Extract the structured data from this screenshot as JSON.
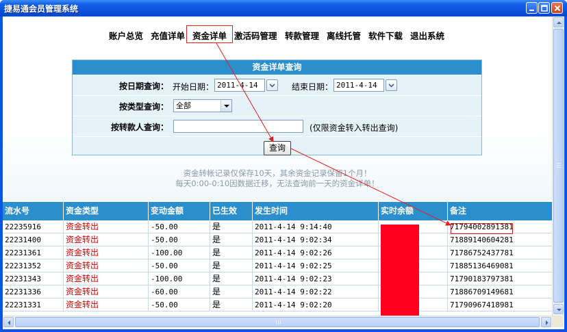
{
  "window": {
    "title": "捷易通会员管理系统",
    "accent": "#2a8fcc",
    "title_bar_color": "#0a55e6"
  },
  "nav": {
    "items": [
      {
        "label": "账户总览",
        "name": "nav-account-overview"
      },
      {
        "label": "充值详单",
        "name": "nav-recharge-detail"
      },
      {
        "label": "资金详单",
        "name": "nav-fund-detail",
        "selected": true
      },
      {
        "label": "激活码管理",
        "name": "nav-activation-code"
      },
      {
        "label": "转款管理",
        "name": "nav-transfer-mgmt"
      },
      {
        "label": "离线托管",
        "name": "nav-offline-hosting"
      },
      {
        "label": "软件下载",
        "name": "nav-software-download"
      },
      {
        "label": "退出系统",
        "name": "nav-exit"
      }
    ]
  },
  "query": {
    "title": "资金详单查询",
    "date_label": "按日期查询：",
    "start_label": "开始日期：",
    "start_value": "2011-4-14",
    "end_label": "结束日期：",
    "end_value": "2011-4-14",
    "type_label": "按类型查询：",
    "type_value": "全部",
    "payee_label": "按转款人查询：",
    "payee_value": "",
    "payee_hint": "(仅限资金转入转出查询)",
    "button": "查询"
  },
  "notice": {
    "line1": "资金转帐记录仅保存10天，其余资金记录保留1个月！",
    "line2": "每天0:00-0:10因数据迁移，无法查询前一天的资金详单！"
  },
  "table": {
    "headers": [
      "流水号",
      "资金类型",
      "变动金额",
      "已生效",
      "发生时间",
      "实时余额",
      "备注"
    ],
    "rows": [
      {
        "id": "22235916",
        "type": "资金转出",
        "amount": "-50.00",
        "effective": "是",
        "time": "2011-4-14  9:14:40",
        "balance": "",
        "note": "71794002891381"
      },
      {
        "id": "22231400",
        "type": "资金转出",
        "amount": "-50.00",
        "effective": "是",
        "time": "2011-4-14  9:02:34",
        "balance": "",
        "note": "71889140604281"
      },
      {
        "id": "22231361",
        "type": "资金转出",
        "amount": "-100.00",
        "effective": "是",
        "time": "2011-4-14  9:02:26",
        "balance": "",
        "note": "71786752437781"
      },
      {
        "id": "22231352",
        "type": "资金转出",
        "amount": "-50.00",
        "effective": "是",
        "time": "2011-4-14  9:02:25",
        "balance": "",
        "note": "71885136469081"
      },
      {
        "id": "22231343",
        "type": "资金转出",
        "amount": "-100.00",
        "effective": "是",
        "time": "2011-4-14  9:02:23",
        "balance": "",
        "note": "71790183797381"
      },
      {
        "id": "22231336",
        "type": "资金转出",
        "amount": "-60.00",
        "effective": "是",
        "time": "2011-4-14  9:02:22",
        "balance": "",
        "note": "71886709149681"
      },
      {
        "id": "22231331",
        "type": "资金转出",
        "amount": "-50.00",
        "effective": "是",
        "time": "2011-4-14  9:02:20",
        "balance": "",
        "note": "71790967418981"
      }
    ]
  },
  "icons": {
    "minimize": "minimize-icon",
    "maximize": "maximize-icon",
    "close": "close-icon",
    "calendar_dropdown": "chevron-down-icon"
  },
  "colors": {
    "outflow_type": "#d40000",
    "redaction": "#ff0020",
    "annotation": "#e02020"
  }
}
